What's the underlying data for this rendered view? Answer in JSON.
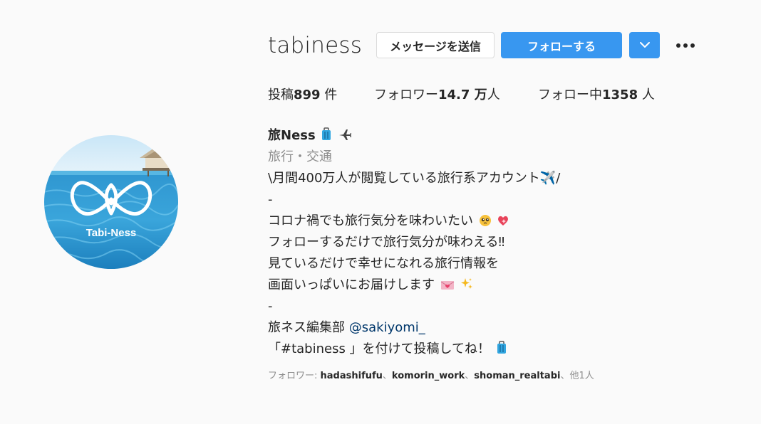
{
  "profile": {
    "username": "tabiness",
    "avatar_text": "Tabi-Ness",
    "avatar_icon": "infinity-heart-logo"
  },
  "actions": {
    "message_label": "メッセージを送信",
    "follow_label": "フォローする",
    "dropdown_icon": "chevron-down-icon",
    "more_icon": "more-horizontal-icon"
  },
  "stats": {
    "posts_label": "投稿",
    "posts_value": "899",
    "posts_unit": " 件",
    "followers_label": "フォロワー",
    "followers_value": "14.7 万",
    "followers_unit": "人",
    "following_label": "フォロー中",
    "following_value": "1358",
    "following_unit": " 人"
  },
  "bio": {
    "name": "旅Ness",
    "category": "旅行・交通",
    "lines": [
      "\\月間400万人が閲覧している旅行系アカウント✈️/",
      "-",
      "コロナ禍でも旅行気分を味わいたい",
      "フォローするだけで旅行気分が味わえる‼",
      "見ているだけで幸せになれる旅行情報を",
      "画面いっぱいにお届けします",
      "-",
      "旅ネス編集部 ",
      "@sakiyomi_",
      "「#tabiness 」を付けて投稿してね！"
    ]
  },
  "followed_by": {
    "prefix": "フォロワー: ",
    "users": [
      "hadashifufu",
      "komorin_work",
      "shoman_realtabi"
    ],
    "separator": "、",
    "suffix": "他1人"
  },
  "colors": {
    "primary_blue": "#3897f0",
    "background": "#fafafa",
    "text": "#262626",
    "secondary_text": "#8e8e8e",
    "link": "#00376b"
  }
}
